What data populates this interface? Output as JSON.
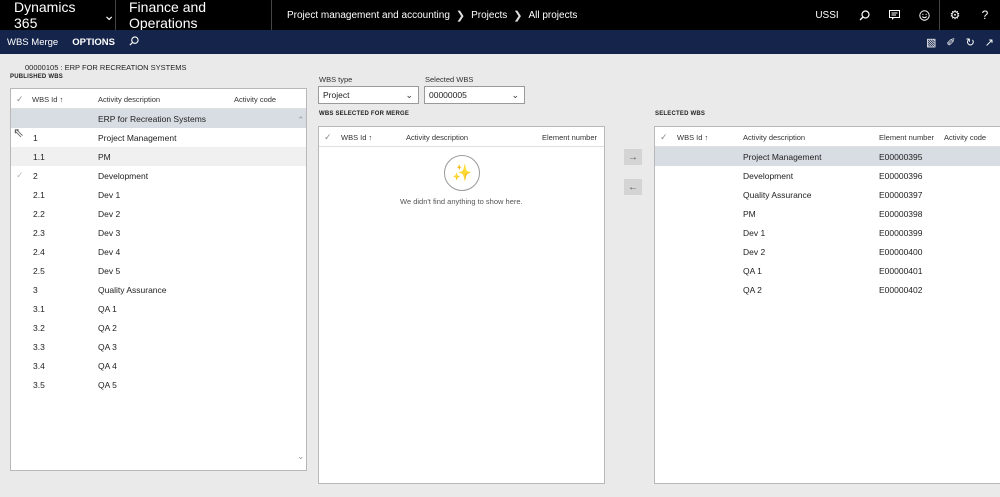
{
  "nav": {
    "brand": "Dynamics 365",
    "module": "Finance and Operations",
    "breadcrumb": [
      "Project management and accounting",
      "Projects",
      "All projects"
    ],
    "company": "USSI"
  },
  "actionpane": {
    "tab": "WBS Merge",
    "options": "OPTIONS"
  },
  "record_title": "00000105 : ERP FOR RECREATION SYSTEMS",
  "published": {
    "label": "PUBLISHED WBS",
    "headers": {
      "id": "WBS Id",
      "desc": "Activity description",
      "code": "Activity code"
    },
    "rows": [
      {
        "id": "",
        "desc": "ERP for Recreation Systems"
      },
      {
        "id": "1",
        "desc": "Project Management"
      },
      {
        "id": "1.1",
        "desc": "PM"
      },
      {
        "id": "2",
        "desc": "Development"
      },
      {
        "id": "2.1",
        "desc": "Dev 1"
      },
      {
        "id": "2.2",
        "desc": "Dev 2"
      },
      {
        "id": "2.3",
        "desc": "Dev 3"
      },
      {
        "id": "2.4",
        "desc": "Dev 4"
      },
      {
        "id": "2.5",
        "desc": "Dev 5"
      },
      {
        "id": "3",
        "desc": "Quality Assurance"
      },
      {
        "id": "3.1",
        "desc": "QA 1"
      },
      {
        "id": "3.2",
        "desc": "QA 2"
      },
      {
        "id": "3.3",
        "desc": "QA 3"
      },
      {
        "id": "3.4",
        "desc": "QA 4"
      },
      {
        "id": "3.5",
        "desc": "QA 5"
      }
    ]
  },
  "filters": {
    "wbs_type_label": "WBS type",
    "wbs_type_value": "Project",
    "selected_wbs_label": "Selected WBS",
    "selected_wbs_value": "00000005"
  },
  "merge": {
    "label": "WBS SELECTED FOR MERGE",
    "headers": {
      "id": "WBS Id",
      "desc": "Activity description",
      "elem": "Element number"
    },
    "empty_text": "We didn't find anything to show here."
  },
  "selected": {
    "label": "SELECTED WBS",
    "headers": {
      "id": "WBS Id",
      "desc": "Activity description",
      "elem": "Element number",
      "code": "Activity code"
    },
    "rows": [
      {
        "desc": "Project Management",
        "elem": "E00000395"
      },
      {
        "desc": "Development",
        "elem": "E00000396"
      },
      {
        "desc": "Quality Assurance",
        "elem": "E00000397"
      },
      {
        "desc": "PM",
        "elem": "E00000398"
      },
      {
        "desc": "Dev 1",
        "elem": "E00000399"
      },
      {
        "desc": "Dev 2",
        "elem": "E00000400"
      },
      {
        "desc": "QA 1",
        "elem": "E00000401"
      },
      {
        "desc": "QA 2",
        "elem": "E00000402"
      }
    ]
  },
  "icons": {
    "brand_chevron": "chevron-down-icon",
    "search": "search-icon",
    "chat": "message-icon",
    "smile": "feedback-icon",
    "gear": "gear-icon",
    "help": "help-icon"
  }
}
